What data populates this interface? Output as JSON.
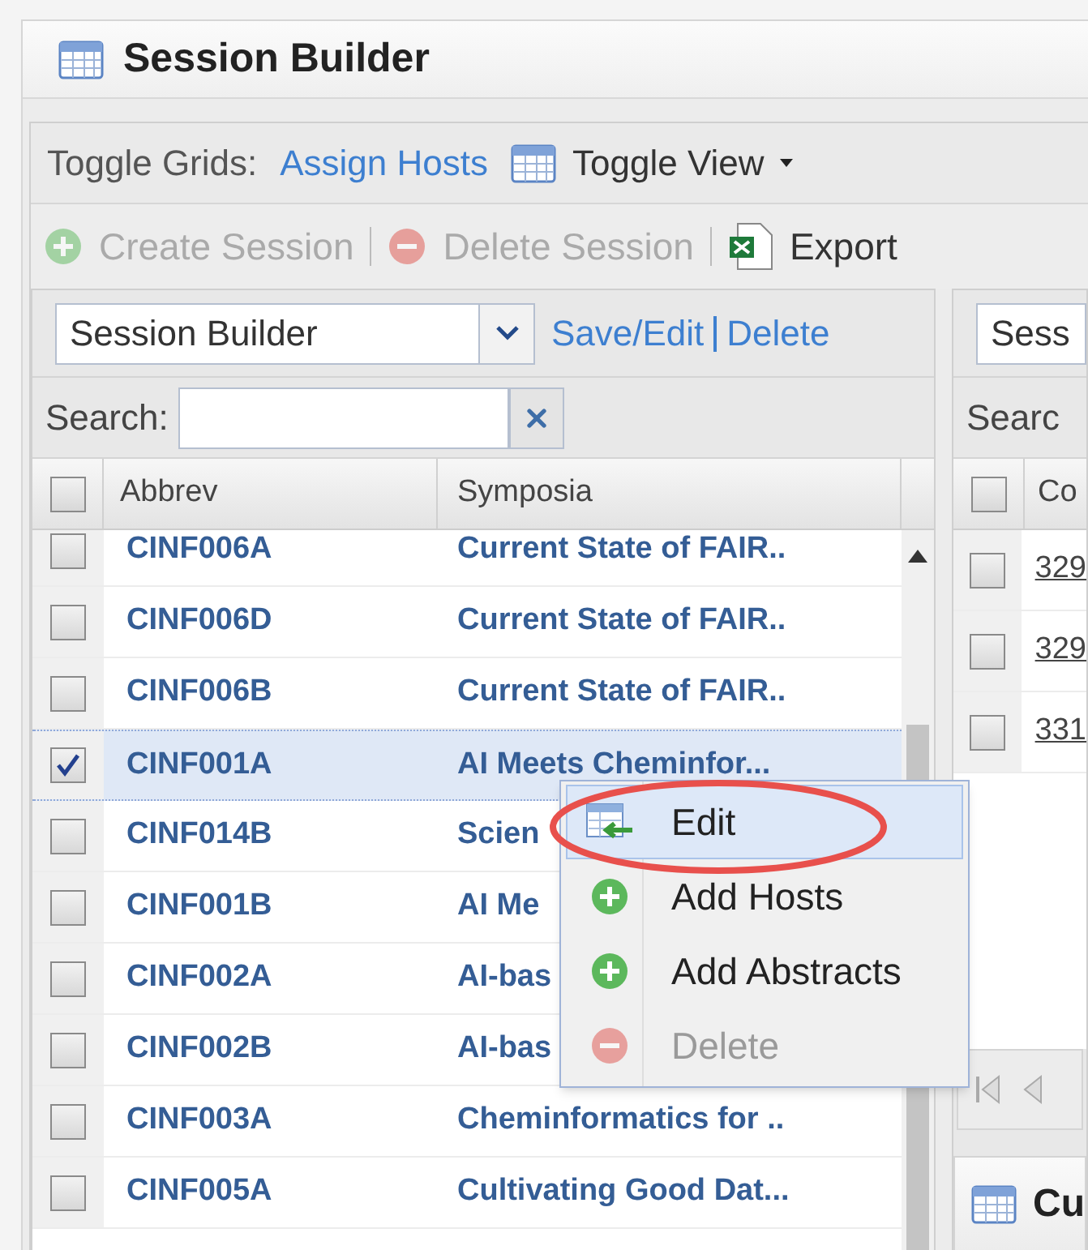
{
  "window": {
    "title": "Session Builder"
  },
  "toolbar": {
    "label": "Toggle Grids:",
    "link": "Assign Hosts",
    "view_menu": "Toggle View"
  },
  "actions": [
    {
      "label": "Create Session",
      "kind": "create",
      "disabled": true
    },
    {
      "label": "Delete Session",
      "kind": "delete",
      "disabled": true
    },
    {
      "label": "Export",
      "kind": "export",
      "disabled": false
    }
  ],
  "left_grid": {
    "view_select": "Session Builder",
    "links": [
      "Save/Edit",
      "Delete"
    ],
    "search_label": "Search:",
    "select_all": false,
    "columns": [
      "Abbrev",
      "Symposia"
    ],
    "rows": [
      {
        "abbrev": "CINF006A",
        "symposia": "Current State of FAIR..",
        "checked": false,
        "selected": false
      },
      {
        "abbrev": "CINF006D",
        "symposia": "Current State of FAIR..",
        "checked": false,
        "selected": false
      },
      {
        "abbrev": "CINF006B",
        "symposia": "Current State of FAIR..",
        "checked": false,
        "selected": false
      },
      {
        "abbrev": "CINF001A",
        "symposia": "AI Meets Cheminfor...",
        "checked": true,
        "selected": true
      },
      {
        "abbrev": "CINF014B",
        "symposia": "Scien",
        "checked": false,
        "selected": false
      },
      {
        "abbrev": "CINF001B",
        "symposia": "AI Me",
        "checked": false,
        "selected": false
      },
      {
        "abbrev": "CINF002A",
        "symposia": "AI-bas",
        "checked": false,
        "selected": false
      },
      {
        "abbrev": "CINF002B",
        "symposia": "AI-bas",
        "checked": false,
        "selected": false
      },
      {
        "abbrev": "CINF003A",
        "symposia": "Cheminformatics for ..",
        "checked": false,
        "selected": false
      },
      {
        "abbrev": "CINF005A",
        "symposia": "Cultivating Good Dat...",
        "checked": false,
        "selected": false
      }
    ]
  },
  "right_grid": {
    "view_select": "Sess",
    "search_label": "Searc",
    "select_all": false,
    "columns": [
      "Co"
    ],
    "rows": [
      {
        "value": "329",
        "checked": false
      },
      {
        "value": "329",
        "checked": false
      },
      {
        "value": "331",
        "checked": false
      }
    ]
  },
  "context_menu": {
    "items": [
      {
        "label": "Edit",
        "kind": "edit",
        "disabled": false,
        "selected": true
      },
      {
        "label": "Add Hosts",
        "kind": "add",
        "disabled": false,
        "selected": false
      },
      {
        "label": "Add Abstracts",
        "kind": "add",
        "disabled": false,
        "selected": false
      },
      {
        "label": "Delete",
        "kind": "delete",
        "disabled": true,
        "selected": false
      }
    ]
  },
  "bottom_panel": {
    "title": "Cu"
  }
}
